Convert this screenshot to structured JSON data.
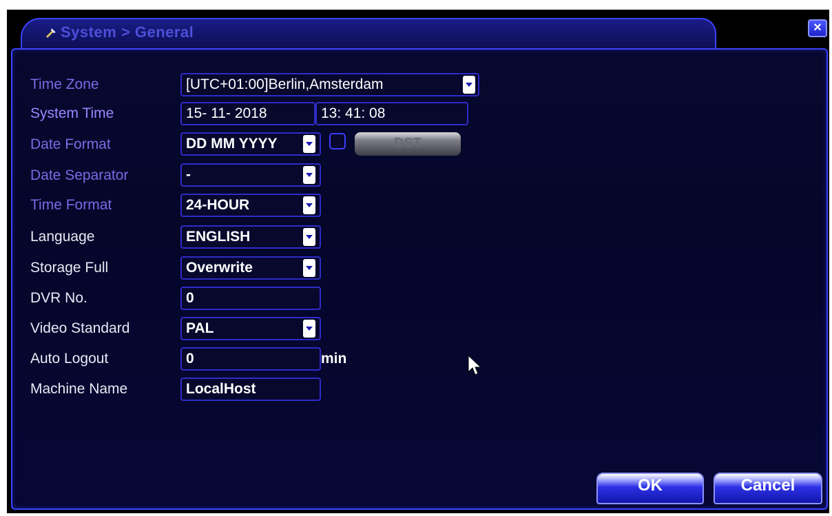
{
  "title": "System > General",
  "close_label": "×",
  "rows": [
    {
      "label": "Time Zone",
      "value": "[UTC+01:00]Berlin,Amsterdam"
    },
    {
      "label": "System Time",
      "date": "15- 11- 2018",
      "time": "13: 41: 08"
    },
    {
      "label": "Date Format",
      "value": "DD MM YYYY"
    },
    {
      "label": "Date Separator",
      "value": "-"
    },
    {
      "label": "Time Format",
      "value": "24-HOUR"
    },
    {
      "label": "Language",
      "value": "ENGLISH"
    },
    {
      "label": "Storage Full",
      "value": "Overwrite"
    },
    {
      "label": "DVR No.",
      "value": "0"
    },
    {
      "label": "Video Standard",
      "value": "PAL"
    },
    {
      "label": "Auto Logout",
      "value": "0",
      "unit": "min"
    },
    {
      "label": "Machine Name",
      "value": "LocalHost"
    }
  ],
  "dst_label": "DST",
  "ok_label": "OK",
  "cancel_label": "Cancel",
  "icons": {
    "title": "tools-icon",
    "cursor": "mouse-pointer-icon"
  },
  "colors": {
    "accent": "#3a44ff",
    "background": "#05062a",
    "title_text": "#4d4fd8"
  }
}
